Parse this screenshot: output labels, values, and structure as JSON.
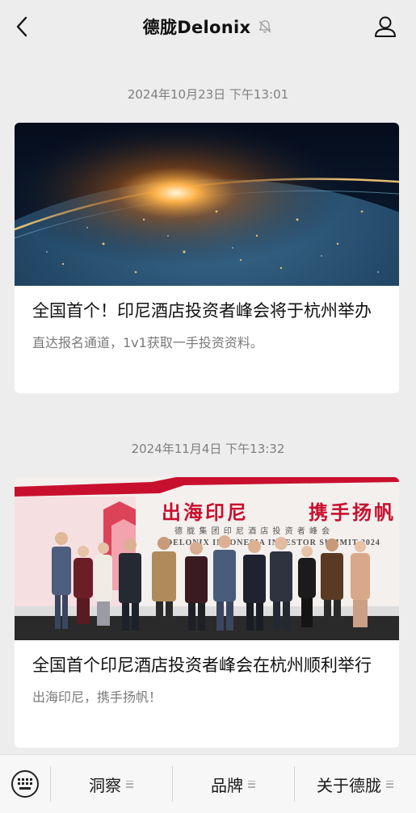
{
  "header": {
    "title": "德胧Delonix"
  },
  "feed": [
    {
      "timestamp": "2024年10月23日 下午13:01",
      "title": "全国首个！印尼酒店投资者峰会将于杭州举办",
      "subtitle": "直达报名通道，1v1获取一手投资资料。"
    },
    {
      "timestamp": "2024年11月4日 下午13:32",
      "title": "全国首个印尼酒店投资者峰会在杭州顺利举行",
      "subtitle": "出海印尼，携手扬帆！",
      "banner_title_left": "出海印尼",
      "banner_title_right": "携手扬帆",
      "banner_subtitle": "德 胧 集 团 印 尼 酒 店 投 资 者 峰 会",
      "banner_en": "DELONIX INDONESIA INVESTOR SUMMIT 2024"
    }
  ],
  "bottom_menu": {
    "items": [
      {
        "label": "洞察"
      },
      {
        "label": "品牌"
      },
      {
        "label": "关于德胧"
      }
    ]
  },
  "colors": {
    "background": "#ededed",
    "card": "#ffffff",
    "banner_red": "#c8102e"
  }
}
